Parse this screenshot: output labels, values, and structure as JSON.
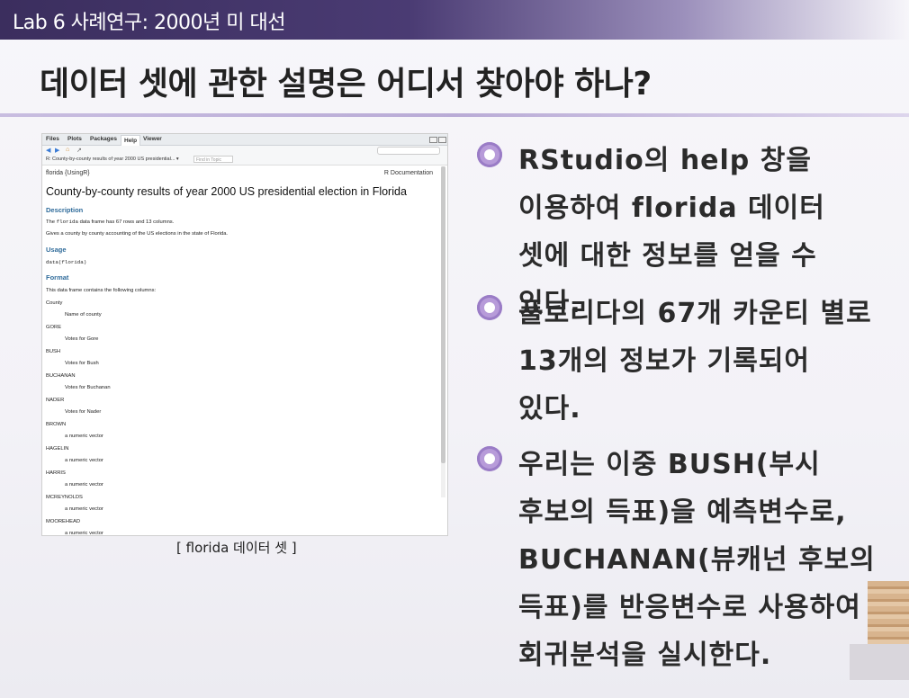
{
  "header": {
    "lab_title": "Lab 6 사례연구: 2000년 미 대선"
  },
  "slide": {
    "title": "데이터 셋에 관한 설명은 어디서 찾아야 하나?"
  },
  "rstudio": {
    "tabs": [
      "Files",
      "Plots",
      "Packages",
      "Help",
      "Viewer"
    ],
    "active_tab": "Help",
    "address": "R: County-by-county results of year 2000 US presidential... ▾",
    "find_placeholder": "Find in Topic",
    "doc": {
      "header_left": "florida {UsingR}",
      "header_right": "R Documentation",
      "title": "County-by-county results of year 2000 US presidential election in Florida",
      "description_heading": "Description",
      "description_line1_pre": "The ",
      "description_line1_code": "florida",
      "description_line1_post": " data frame has 67 rows and 13 columns.",
      "description_line2": "Gives a county by county accounting of the US elections in the state of Florida.",
      "usage_heading": "Usage",
      "usage_code": "data(florida)",
      "format_heading": "Format",
      "format_intro": "This data frame contains the following columns:",
      "columns": [
        {
          "name": "County",
          "desc": "Name of county"
        },
        {
          "name": "GORE",
          "desc": "Votes for Gore"
        },
        {
          "name": "BUSH",
          "desc": "Votes for Bush"
        },
        {
          "name": "BUCHANAN",
          "desc": "Votes for Buchanan"
        },
        {
          "name": "NADER",
          "desc": "Votes for Nader"
        },
        {
          "name": "BROWN",
          "desc": "a numeric vector"
        },
        {
          "name": "HAGELIN",
          "desc": "a numeric vector"
        },
        {
          "name": "HARRIS",
          "desc": "a numeric vector"
        },
        {
          "name": "MCREYNOLDS",
          "desc": "a numeric vector"
        },
        {
          "name": "MOOREHEAD",
          "desc": "a numeric vector"
        }
      ]
    }
  },
  "caption": "[ florida 데이터 셋 ]",
  "bullets": [
    "RStudio의 help 창을 이용하여 florida 데이터 셋에 대한 정보를 얻을 수 있다.",
    "플로리다의 67개 카운티 별로 13개의 정보가 기록되어 있다.",
    "우리는 이중 BUSH(부시 후보의 득표)을 예측변수로, BUCHANAN(뷰캐넌 후보의 득표)를 반응변수로 사용하여 회귀분석을 실시한다."
  ],
  "colors": {
    "header_bar": "#3b2e5e",
    "bullet_accent": "#b79bd9",
    "doc_heading": "#2f6b9a"
  }
}
